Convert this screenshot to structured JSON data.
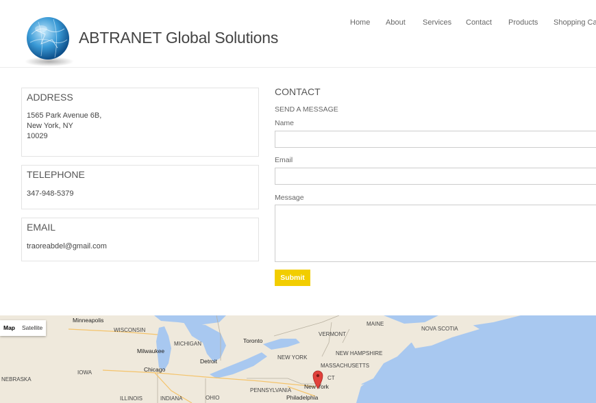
{
  "header": {
    "brand": "ABTRANET Global Solutions",
    "nav": [
      "Home",
      "About",
      "Services",
      "Contact",
      "Products",
      "Shopping Car"
    ]
  },
  "address": {
    "title": "ADDRESS",
    "line1": "1565 Park Avenue 6B,",
    "line2": "New York, NY",
    "line3": "10029"
  },
  "telephone": {
    "title": "TELEPHONE",
    "value": "347-948-5379"
  },
  "email": {
    "title": "EMAIL",
    "value": "traoreabdel@gmail.com"
  },
  "contact": {
    "title": "CONTACT",
    "subtitle": "SEND A MESSAGE",
    "name_label": "Name",
    "email_label": "Email",
    "message_label": "Message",
    "name_value": "",
    "email_value": "",
    "message_value": "",
    "submit_label": "Submit"
  },
  "map": {
    "map_label": "Map",
    "satellite_label": "Satellite",
    "labels": [
      "Minneapolis",
      "WISCONSIN",
      "MICHIGAN",
      "Milwaukee",
      "Toronto",
      "VERMONT",
      "MAINE",
      "NOVA SCOTIA",
      "NEW HAMPSHIRE",
      "NEW YORK",
      "Detroit",
      "Chicago",
      "IOWA",
      "MASSACHUSETTS",
      "NEBRASKA",
      "PENNSYLVANIA",
      "CT",
      "New York",
      "ILLINOIS",
      "INDIANA",
      "OHIO",
      "Philadelphia"
    ],
    "colors": {
      "land": "#efe9dc",
      "water": "#a8c8f0",
      "marker": "#e0413b"
    }
  },
  "colors": {
    "submit": "#f2cd00",
    "border": "#e3e3e3"
  }
}
